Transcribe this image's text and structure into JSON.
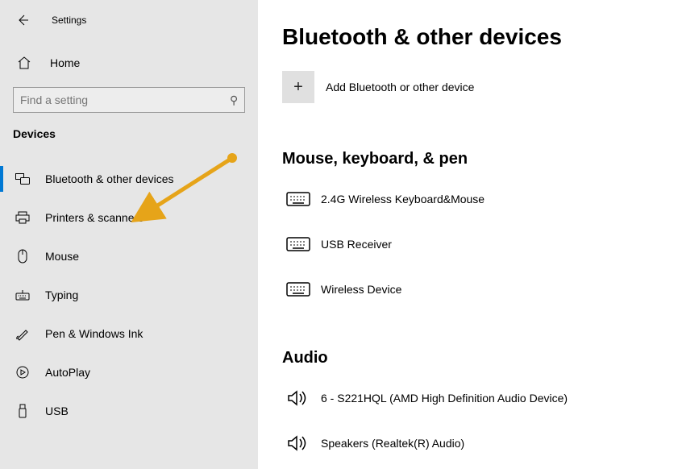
{
  "app_title": "Settings",
  "home_label": "Home",
  "search_placeholder": "Find a setting",
  "category_label": "Devices",
  "sidebar": {
    "items": [
      {
        "label": "Bluetooth & other devices"
      },
      {
        "label": "Printers & scanners"
      },
      {
        "label": "Mouse"
      },
      {
        "label": "Typing"
      },
      {
        "label": "Pen & Windows Ink"
      },
      {
        "label": "AutoPlay"
      },
      {
        "label": "USB"
      }
    ]
  },
  "page_title": "Bluetooth & other devices",
  "add_device_label": "Add Bluetooth or other device",
  "section_input_heading": "Mouse, keyboard, & pen",
  "devices_input": [
    {
      "label": "2.4G Wireless Keyboard&Mouse"
    },
    {
      "label": "USB Receiver"
    },
    {
      "label": "Wireless Device"
    }
  ],
  "section_audio_heading": "Audio",
  "devices_audio": [
    {
      "label": "6 - S221HQL (AMD High Definition Audio Device)"
    },
    {
      "label": "Speakers (Realtek(R) Audio)"
    }
  ]
}
